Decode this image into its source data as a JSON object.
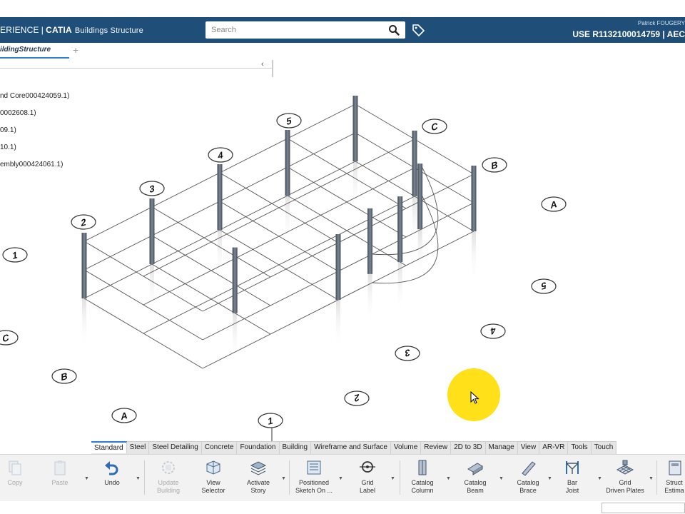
{
  "header": {
    "brand_prefix": "ERIENCE",
    "brand_sep": "|",
    "brand_catia": "CATIA",
    "app_name": "Buildings Structure",
    "search_placeholder": "Search",
    "user_name": "Patrick FOUGERY",
    "user_line": "USE R1132100014759 | AEC"
  },
  "doc_tab": {
    "label": "ildingStructure",
    "add": "+"
  },
  "tree": {
    "collapse": "‹",
    "items": [
      "nd Core000424059.1)",
      "0002608.1)",
      "09.1)",
      "10.1)",
      "embly000424061.1)"
    ]
  },
  "grid_labels": {
    "top": [
      "2",
      "3",
      "4",
      "5"
    ],
    "left": [
      "1",
      "C",
      "B",
      "A"
    ],
    "right": [
      "C",
      "B",
      "A"
    ],
    "bottom": [
      "1",
      "2",
      "3",
      "4",
      "5"
    ]
  },
  "section_tabs": [
    "Standard",
    "Steel",
    "Steel Detailing",
    "Concrete",
    "Foundation",
    "Building",
    "Wireframe and Surface",
    "Volume",
    "Review",
    "2D to 3D",
    "Manage",
    "View",
    "AR-VR",
    "Tools",
    "Touch"
  ],
  "active_section": "Standard",
  "tools": {
    "copy": "Copy",
    "paste": "Paste",
    "undo": "Undo",
    "update_building_1": "Update",
    "update_building_2": "Building",
    "view_selector_1": "View",
    "view_selector_2": "Selector",
    "activate_story_1": "Activate",
    "activate_story_2": "Story",
    "positioned_sketch_1": "Positioned",
    "positioned_sketch_2": "Sketch On ...",
    "grid_label_1": "Grid",
    "grid_label_2": "Label",
    "catalog_column_1": "Catalog",
    "catalog_column_2": "Column",
    "catalog_beam_1": "Catalog",
    "catalog_beam_2": "Beam",
    "catalog_brace_1": "Catalog",
    "catalog_brace_2": "Brace",
    "bar_joist_1": "Bar",
    "bar_joist_2": "Joist",
    "grid_plates_1": "Grid",
    "grid_plates_2": "Driven Plates",
    "structure_1": "Struct",
    "structure_2": "Estima"
  },
  "colors": {
    "header_bg": "#1f4e79",
    "accent": "#2a7fcf",
    "cursor_highlight": "#ffdd00",
    "column": "#5f6b78"
  }
}
